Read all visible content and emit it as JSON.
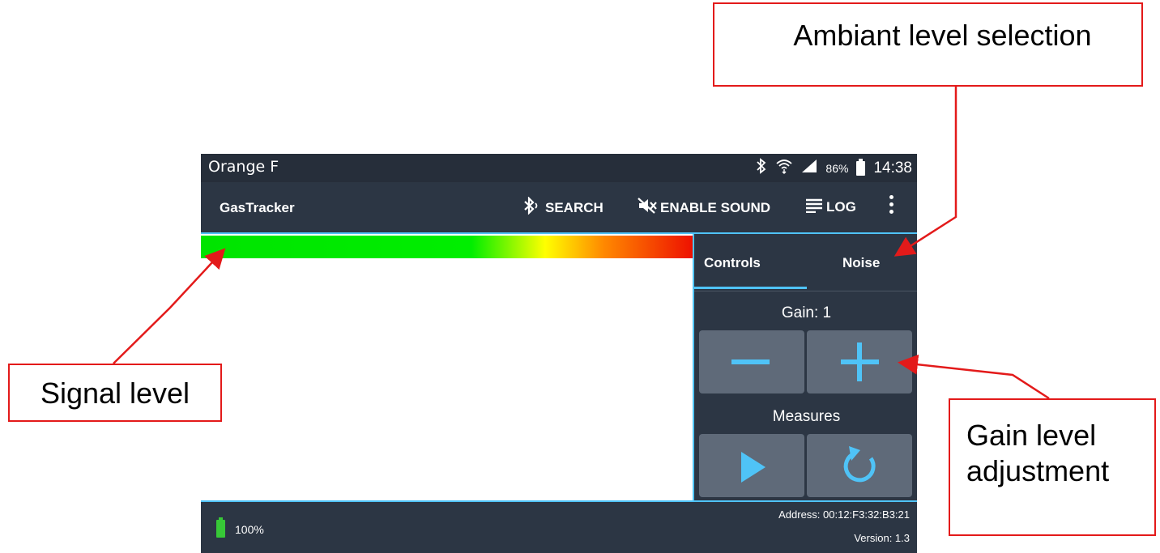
{
  "status_bar": {
    "carrier": "Orange F",
    "battery_percent": "86%",
    "time": "14:38",
    "icons": [
      "bluetooth-icon",
      "wifi-icon",
      "signal-icon",
      "battery-icon"
    ]
  },
  "app_bar": {
    "title": "GasTracker",
    "search_label": "SEARCH",
    "sound_label": "ENABLE SOUND",
    "log_label": "LOG"
  },
  "signal": {
    "level_fraction": 1.0
  },
  "side_panel": {
    "tabs": [
      {
        "label": "Controls",
        "active": true
      },
      {
        "label": "Noise",
        "active": false
      }
    ],
    "gain_label": "Gain: 1",
    "measures_label": "Measures"
  },
  "footer": {
    "battery_percent": "100%",
    "address": "Address: 00:12:F3:32:B3:21",
    "version": "Version: 1.3"
  },
  "annotations": {
    "ambient": "Ambiant level selection",
    "signal": "Signal level",
    "gain": "Gain level adjustment"
  },
  "colors": {
    "accent": "#4fc3f7",
    "annotation": "#e31a1a",
    "battery_green": "#37c837"
  }
}
